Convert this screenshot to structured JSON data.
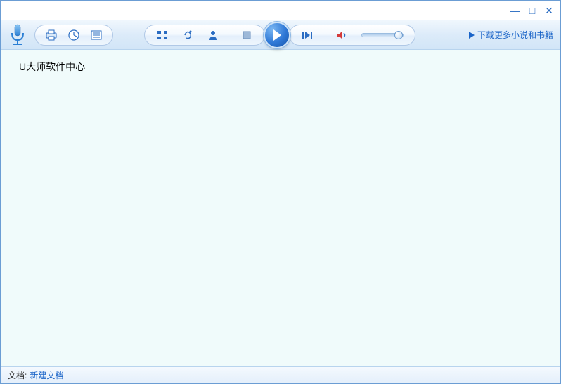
{
  "window_controls": {
    "minimize": "—",
    "maximize": "□",
    "close": "✕"
  },
  "toolbar": {
    "download_label": "下载更多小说和书籍"
  },
  "content": {
    "text": "U大师软件中心"
  },
  "statusbar": {
    "label": "文档:",
    "value": "新建文档"
  }
}
